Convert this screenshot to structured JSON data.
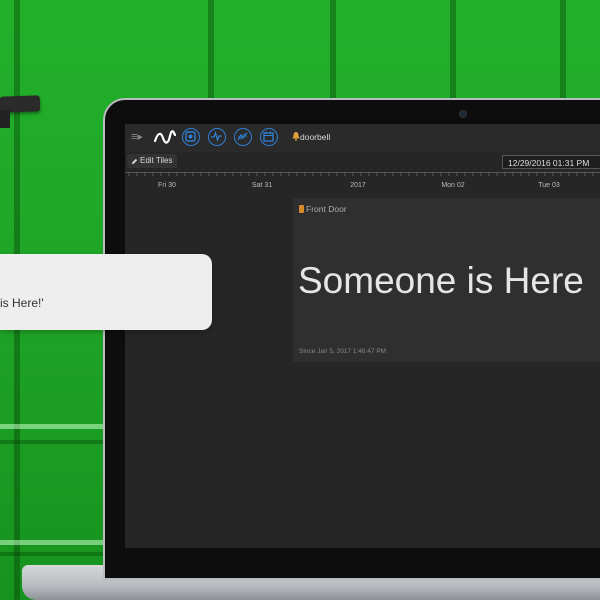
{
  "background": {
    "color": "#1fa626"
  },
  "toolbar": {
    "menu_icon": "hamburger-menu-icon",
    "logo_icon": "wave-logo-icon",
    "buttons": [
      {
        "icon": "dashboard-icon"
      },
      {
        "icon": "activity-icon"
      },
      {
        "icon": "graph-icon"
      },
      {
        "icon": "calendar-icon"
      }
    ],
    "device_icon": "bell-icon",
    "device_label": "doorbell",
    "accent": "#2f7fd6"
  },
  "subbar": {
    "edit_label": "Edit Tiles",
    "date_value": "12/29/2016 01:31 PM"
  },
  "timeline": {
    "labels": [
      "Fri 30",
      "Sat 31",
      "2017",
      "Mon 02",
      "Tue 03"
    ]
  },
  "tile": {
    "title": "Front Door",
    "icon": "door-icon",
    "status": "Someone is Here",
    "since": "Since Jan 5, 2017 1:46:47 PM"
  },
  "notification": {
    "text": "is Here!'"
  }
}
